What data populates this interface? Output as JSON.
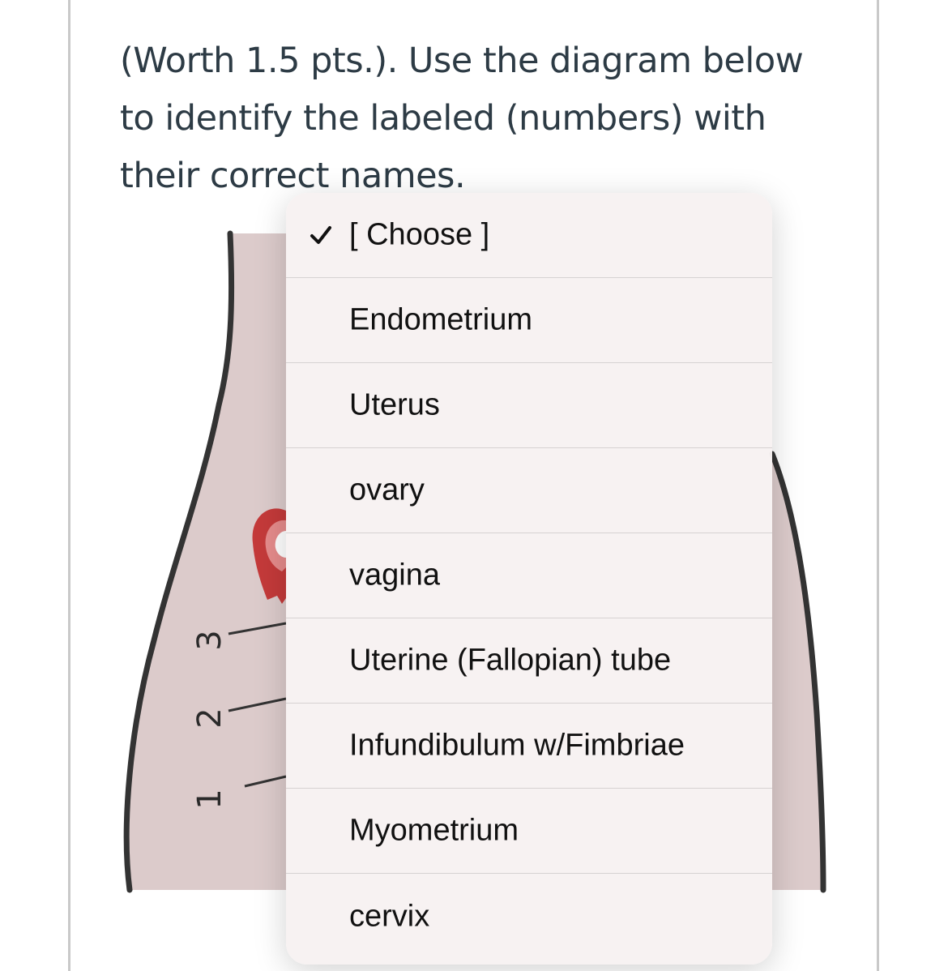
{
  "question": {
    "line1": "(Worth 1.5 pts.). Use the diagram below",
    "line2": "to identify the labeled (numbers) with",
    "line3": "their correct names."
  },
  "diagram": {
    "labels": [
      "3",
      "2",
      "1"
    ]
  },
  "dropdown": {
    "selected_index": 0,
    "options": [
      "[ Choose ]",
      "Endometrium",
      "Uterus",
      "ovary",
      "vagina",
      "Uterine (Fallopian) tube",
      "Infundibulum w/Fimbriae",
      "Myometrium",
      "cervix"
    ]
  },
  "colors": {
    "body_fill": "#dccbcb",
    "outline": "#333333",
    "ovary_red": "#c43a3a"
  }
}
